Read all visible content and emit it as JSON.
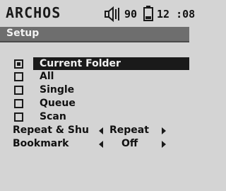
{
  "status": {
    "brand": "ARCHOS",
    "volume": "90",
    "time": "12 :08"
  },
  "screen": {
    "title": "Setup"
  },
  "options": [
    {
      "label": "Current Folder",
      "checked": true,
      "selected": true
    },
    {
      "label": "All",
      "checked": false,
      "selected": false
    },
    {
      "label": "Single",
      "checked": false,
      "selected": false
    },
    {
      "label": "Queue",
      "checked": false,
      "selected": false
    },
    {
      "label": "Scan",
      "checked": false,
      "selected": false
    }
  ],
  "settings": [
    {
      "label": "Repeat & Shu",
      "value": "Repeat"
    },
    {
      "label": "Bookmark",
      "value": "Off"
    }
  ]
}
